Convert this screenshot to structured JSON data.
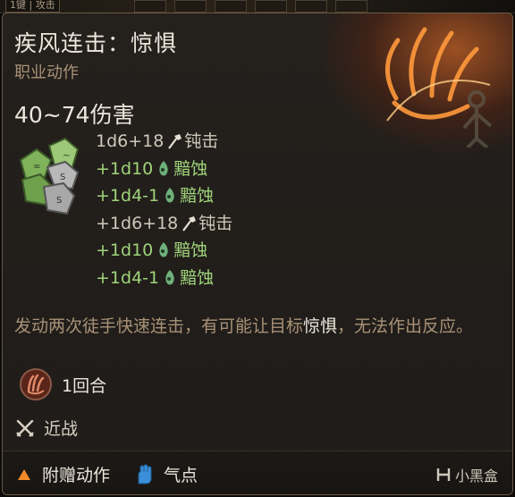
{
  "topbar": {
    "label": "1键 | 攻击"
  },
  "tooltip": {
    "title": "疾风连击：惊惧",
    "subtitle": "职业动作",
    "damage_total": "40~74伤害",
    "damage_rows": [
      {
        "amount": "1d6+18",
        "type": "钝击",
        "kind": "bludgeon"
      },
      {
        "amount": "+1d10",
        "type": "黯蚀",
        "kind": "necrotic"
      },
      {
        "amount": "+1d4-1",
        "type": "黯蚀",
        "kind": "necrotic"
      },
      {
        "amount": "+1d6+18",
        "type": "钝击",
        "kind": "bludgeon"
      },
      {
        "amount": "+1d10",
        "type": "黯蚀",
        "kind": "necrotic"
      },
      {
        "amount": "+1d4-1",
        "type": "黯蚀",
        "kind": "necrotic"
      }
    ],
    "description_before": "发动两次徒手快速连击，有可能让目标",
    "description_highlight": "惊惧",
    "description_after": "，无法作出反应。",
    "duration": "1回合",
    "range": "近战",
    "footer": {
      "bonus_action": "附赠动作",
      "ki_points": "气点"
    },
    "watermark": "小黑盒"
  },
  "colors": {
    "title": "#ece6dc",
    "subtitle": "#a89277",
    "necrotic_green": "#9fd37a",
    "bonus_action_orange": "#f08a2a",
    "ki_blue": "#3a8fd8"
  }
}
